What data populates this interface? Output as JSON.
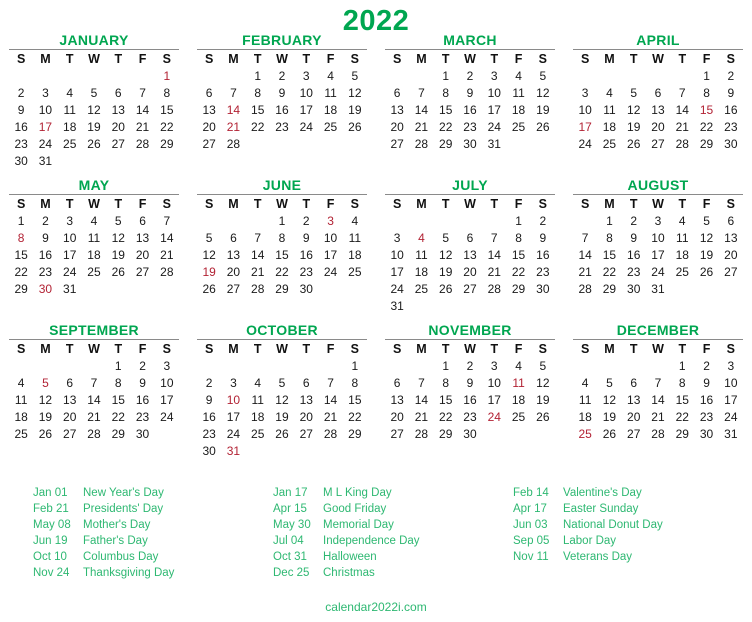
{
  "title": "2022",
  "footer": "calendar2022i.com",
  "colors": {
    "green": "#00A650",
    "legend_green": "#2EB872",
    "holiday_red": "#B22234",
    "day_text": "#1a1a1a",
    "rule": "#8a8a8a"
  },
  "weekday_headers": [
    "S",
    "M",
    "T",
    "W",
    "T",
    "F",
    "S"
  ],
  "months": [
    {
      "name": "JANUARY",
      "weeks": [
        [
          "",
          "",
          "",
          "",
          "",
          "",
          "1"
        ],
        [
          "2",
          "3",
          "4",
          "5",
          "6",
          "7",
          "8"
        ],
        [
          "9",
          "10",
          "11",
          "12",
          "13",
          "14",
          "15"
        ],
        [
          "16",
          "17",
          "18",
          "19",
          "20",
          "21",
          "22"
        ],
        [
          "23",
          "24",
          "25",
          "26",
          "27",
          "28",
          "29"
        ],
        [
          "30",
          "31",
          "",
          "",
          "",
          "",
          ""
        ]
      ],
      "holidays": [
        1,
        17
      ]
    },
    {
      "name": "FEBRUARY",
      "weeks": [
        [
          "",
          "",
          "1",
          "2",
          "3",
          "4",
          "5"
        ],
        [
          "6",
          "7",
          "8",
          "9",
          "10",
          "11",
          "12"
        ],
        [
          "13",
          "14",
          "15",
          "16",
          "17",
          "18",
          "19"
        ],
        [
          "20",
          "21",
          "22",
          "23",
          "24",
          "25",
          "26"
        ],
        [
          "27",
          "28",
          "",
          "",
          "",
          "",
          ""
        ],
        [
          "",
          "",
          "",
          "",
          "",
          "",
          ""
        ]
      ],
      "holidays": [
        14,
        21
      ]
    },
    {
      "name": "MARCH",
      "weeks": [
        [
          "",
          "",
          "1",
          "2",
          "3",
          "4",
          "5"
        ],
        [
          "6",
          "7",
          "8",
          "9",
          "10",
          "11",
          "12"
        ],
        [
          "13",
          "14",
          "15",
          "16",
          "17",
          "18",
          "19"
        ],
        [
          "20",
          "21",
          "22",
          "23",
          "24",
          "25",
          "26"
        ],
        [
          "27",
          "28",
          "29",
          "30",
          "31",
          "",
          ""
        ],
        [
          "",
          "",
          "",
          "",
          "",
          "",
          ""
        ]
      ],
      "holidays": []
    },
    {
      "name": "APRIL",
      "weeks": [
        [
          "",
          "",
          "",
          "",
          "",
          "1",
          "2"
        ],
        [
          "3",
          "4",
          "5",
          "6",
          "7",
          "8",
          "9"
        ],
        [
          "10",
          "11",
          "12",
          "13",
          "14",
          "15",
          "16"
        ],
        [
          "17",
          "18",
          "19",
          "20",
          "21",
          "22",
          "23"
        ],
        [
          "24",
          "25",
          "26",
          "27",
          "28",
          "29",
          "30"
        ],
        [
          "",
          "",
          "",
          "",
          "",
          "",
          ""
        ]
      ],
      "holidays": [
        15,
        17
      ]
    },
    {
      "name": "MAY",
      "weeks": [
        [
          "1",
          "2",
          "3",
          "4",
          "5",
          "6",
          "7"
        ],
        [
          "8",
          "9",
          "10",
          "11",
          "12",
          "13",
          "14"
        ],
        [
          "15",
          "16",
          "17",
          "18",
          "19",
          "20",
          "21"
        ],
        [
          "22",
          "23",
          "24",
          "25",
          "26",
          "27",
          "28"
        ],
        [
          "29",
          "30",
          "31",
          "",
          "",
          "",
          ""
        ],
        [
          "",
          "",
          "",
          "",
          "",
          "",
          ""
        ]
      ],
      "holidays": [
        8,
        30
      ]
    },
    {
      "name": "JUNE",
      "weeks": [
        [
          "",
          "",
          "",
          "1",
          "2",
          "3",
          "4"
        ],
        [
          "5",
          "6",
          "7",
          "8",
          "9",
          "10",
          "11"
        ],
        [
          "12",
          "13",
          "14",
          "15",
          "16",
          "17",
          "18"
        ],
        [
          "19",
          "20",
          "21",
          "22",
          "23",
          "24",
          "25"
        ],
        [
          "26",
          "27",
          "28",
          "29",
          "30",
          "",
          ""
        ],
        [
          "",
          "",
          "",
          "",
          "",
          "",
          ""
        ]
      ],
      "holidays": [
        3,
        19
      ]
    },
    {
      "name": "JULY",
      "weeks": [
        [
          "",
          "",
          "",
          "",
          "",
          "1",
          "2"
        ],
        [
          "3",
          "4",
          "5",
          "6",
          "7",
          "8",
          "9"
        ],
        [
          "10",
          "11",
          "12",
          "13",
          "14",
          "15",
          "16"
        ],
        [
          "17",
          "18",
          "19",
          "20",
          "21",
          "22",
          "23"
        ],
        [
          "24",
          "25",
          "26",
          "27",
          "28",
          "29",
          "30"
        ],
        [
          "31",
          "",
          "",
          "",
          "",
          "",
          ""
        ]
      ],
      "holidays": [
        4
      ]
    },
    {
      "name": "AUGUST",
      "weeks": [
        [
          "",
          "1",
          "2",
          "3",
          "4",
          "5",
          "6"
        ],
        [
          "7",
          "8",
          "9",
          "10",
          "11",
          "12",
          "13"
        ],
        [
          "14",
          "15",
          "16",
          "17",
          "18",
          "19",
          "20"
        ],
        [
          "21",
          "22",
          "23",
          "24",
          "25",
          "26",
          "27"
        ],
        [
          "28",
          "29",
          "30",
          "31",
          "",
          "",
          ""
        ],
        [
          "",
          "",
          "",
          "",
          "",
          "",
          ""
        ]
      ],
      "holidays": []
    },
    {
      "name": "SEPTEMBER",
      "weeks": [
        [
          "",
          "",
          "",
          "",
          "1",
          "2",
          "3"
        ],
        [
          "4",
          "5",
          "6",
          "7",
          "8",
          "9",
          "10"
        ],
        [
          "11",
          "12",
          "13",
          "14",
          "15",
          "16",
          "17"
        ],
        [
          "18",
          "19",
          "20",
          "21",
          "22",
          "23",
          "24"
        ],
        [
          "25",
          "26",
          "27",
          "28",
          "29",
          "30",
          ""
        ],
        [
          "",
          "",
          "",
          "",
          "",
          "",
          ""
        ]
      ],
      "holidays": [
        5
      ]
    },
    {
      "name": "OCTOBER",
      "weeks": [
        [
          "",
          "",
          "",
          "",
          "",
          "",
          "1"
        ],
        [
          "2",
          "3",
          "4",
          "5",
          "6",
          "7",
          "8"
        ],
        [
          "9",
          "10",
          "11",
          "12",
          "13",
          "14",
          "15"
        ],
        [
          "16",
          "17",
          "18",
          "19",
          "20",
          "21",
          "22"
        ],
        [
          "23",
          "24",
          "25",
          "26",
          "27",
          "28",
          "29"
        ],
        [
          "30",
          "31",
          "",
          "",
          "",
          "",
          ""
        ]
      ],
      "holidays": [
        10,
        31
      ]
    },
    {
      "name": "NOVEMBER",
      "weeks": [
        [
          "",
          "",
          "1",
          "2",
          "3",
          "4",
          "5"
        ],
        [
          "6",
          "7",
          "8",
          "9",
          "10",
          "11",
          "12"
        ],
        [
          "13",
          "14",
          "15",
          "16",
          "17",
          "18",
          "19"
        ],
        [
          "20",
          "21",
          "22",
          "23",
          "24",
          "25",
          "26"
        ],
        [
          "27",
          "28",
          "29",
          "30",
          "",
          "",
          ""
        ],
        [
          "",
          "",
          "",
          "",
          "",
          "",
          ""
        ]
      ],
      "holidays": [
        11,
        24
      ]
    },
    {
      "name": "DECEMBER",
      "weeks": [
        [
          "",
          "",
          "",
          "",
          "1",
          "2",
          "3"
        ],
        [
          "4",
          "5",
          "6",
          "7",
          "8",
          "9",
          "10"
        ],
        [
          "11",
          "12",
          "13",
          "14",
          "15",
          "16",
          "17"
        ],
        [
          "18",
          "19",
          "20",
          "21",
          "22",
          "23",
          "24"
        ],
        [
          "25",
          "26",
          "27",
          "28",
          "29",
          "30",
          "31"
        ],
        [
          "",
          "",
          "",
          "",
          "",
          "",
          ""
        ]
      ],
      "holidays": [
        25
      ]
    }
  ],
  "legend": {
    "columns": [
      [
        {
          "date": "Jan 01",
          "label": "New Year's Day"
        },
        {
          "date": "Feb 21",
          "label": "Presidents' Day"
        },
        {
          "date": "May 08",
          "label": "Mother's Day"
        },
        {
          "date": "Jun 19",
          "label": "Father's Day"
        },
        {
          "date": "Oct 10",
          "label": "Columbus Day"
        },
        {
          "date": "Nov 24",
          "label": "Thanksgiving Day"
        }
      ],
      [
        {
          "date": "Jan 17",
          "label": "M L King Day"
        },
        {
          "date": "Apr 15",
          "label": "Good Friday"
        },
        {
          "date": "May 30",
          "label": "Memorial Day"
        },
        {
          "date": "Jul 04",
          "label": "Independence Day"
        },
        {
          "date": "Oct 31",
          "label": "Halloween"
        },
        {
          "date": "Dec 25",
          "label": "Christmas"
        }
      ],
      [
        {
          "date": "Feb 14",
          "label": "Valentine's Day"
        },
        {
          "date": "Apr 17",
          "label": "Easter Sunday"
        },
        {
          "date": "Jun 03",
          "label": "National Donut Day"
        },
        {
          "date": "Sep 05",
          "label": "Labor Day"
        },
        {
          "date": "Nov 11",
          "label": "Veterans Day"
        }
      ]
    ]
  }
}
